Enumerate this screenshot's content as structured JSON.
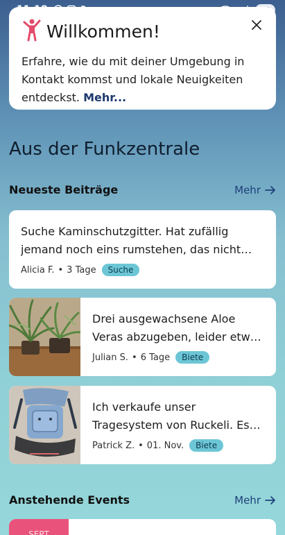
{
  "status_bar": {
    "time": "11:18",
    "battery": "42"
  },
  "welcome": {
    "title": "Willkommen!",
    "text": "Erfahre, wie du mit deiner Umgebung in Kontakt kommst und lokale Neuigkeiten entdeckst.",
    "more": "Mehr..."
  },
  "section": {
    "title": "Aus der Funkzentrale"
  },
  "latest": {
    "title": "Neueste Beiträge",
    "more": "Mehr",
    "posts": [
      {
        "text": "Suche Kaminschutzgitter. Hat zufällig jemand noch eins rumstehen, das nicht mehr gebraucht wird?",
        "author": "Alicia F.",
        "time": "3 Tage",
        "tag": "Suche"
      },
      {
        "text": "Drei ausgewachsene Aloe Veras abzugeben, leider etwas schief gewachsen.",
        "author": "Julian S.",
        "time": "6 Tage",
        "tag": "Biete"
      },
      {
        "text": "Ich verkaufe unser Tragesystem von Ruckeli. Es hat uns bei unseren Ausflügen begleitet.",
        "author": "Patrick Z.",
        "time": "01. Nov.",
        "tag": "Biete"
      }
    ]
  },
  "events": {
    "title": "Anstehende Events",
    "more": "Mehr",
    "first_date": "SEPT"
  },
  "colors": {
    "accent": "#1e3f7a",
    "tag_bg": "#6cc6d6",
    "event_date_bg": "#e9527a",
    "welcome_icon": "#e34b6a"
  }
}
